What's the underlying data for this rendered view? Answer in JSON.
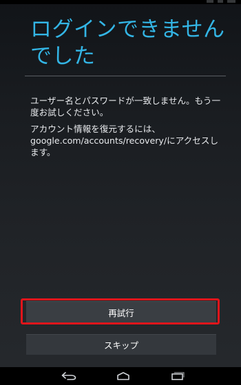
{
  "dialog": {
    "title": "ログインできませんでした",
    "message_1": "ユーザー名とパスワードが一致しません。もう一度お試しください。",
    "message_2": "アカウント情報を復元するには、google.com/accounts/recovery/にアクセスします。"
  },
  "buttons": {
    "retry_label": "再試行",
    "skip_label": "スキップ"
  },
  "colors": {
    "title_accent": "#33b5e5",
    "highlight": "#e0151b"
  },
  "navbar": {
    "icons": [
      "back-icon",
      "home-icon",
      "recent-apps-icon"
    ]
  }
}
